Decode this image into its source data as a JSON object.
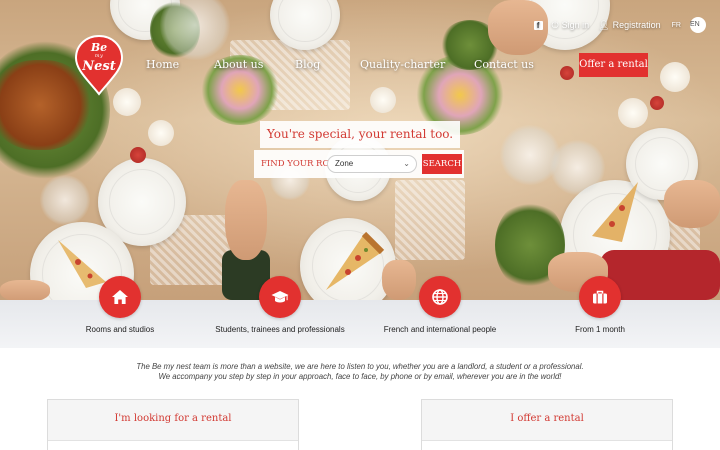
{
  "header": {
    "logo": {
      "line1": "Be",
      "line2": "my",
      "line3": "Nest"
    },
    "topbar": {
      "facebook_icon": "facebook-icon",
      "signin_label": "Sign in",
      "registration_label": "Registration",
      "lang_fr": "FR",
      "lang_en": "EN"
    },
    "nav": [
      "Home",
      "About us",
      "Blog",
      "Quality-charter",
      "Contact us"
    ],
    "offer_button": "Offer a rental"
  },
  "hero": {
    "tagline": "You're special, your rental too.",
    "find_label": "FIND YOUR ROOM",
    "zone_value": "Zone",
    "search_button": "SEARCH"
  },
  "features": [
    {
      "icon": "home-icon",
      "label": "Rooms and studios"
    },
    {
      "icon": "graduation-cap-icon",
      "label": "Students, trainees and professionals"
    },
    {
      "icon": "globe-icon",
      "label": "French and international people"
    },
    {
      "icon": "suitcase-icon",
      "label": "From 1 month"
    }
  ],
  "intro": {
    "line1": "The Be my nest team is more than a website, we are here to listen to you, whether you are a landlord, a student or a professional.",
    "line2": "We accompany you step by step in your approach, face to face, by phone or by email, wherever you are in the world!"
  },
  "panels": {
    "left_title": "I'm looking for a rental",
    "right_title": "I offer a rental"
  },
  "colors": {
    "accent": "#e2312f",
    "accent_text": "#d23a33",
    "band": "#e6e8ec"
  }
}
